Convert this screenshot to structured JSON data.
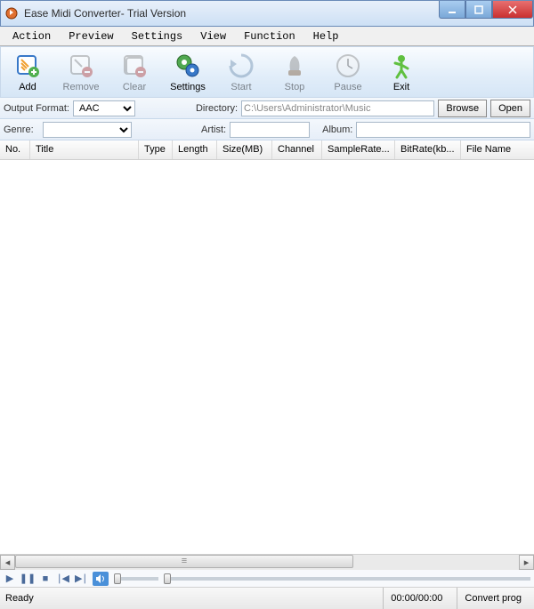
{
  "window": {
    "title": "Ease Midi Converter- Trial Version"
  },
  "menu": [
    "Action",
    "Preview",
    "Settings",
    "View",
    "Function",
    "Help"
  ],
  "toolbar": {
    "add": "Add",
    "remove": "Remove",
    "clear": "Clear",
    "settings": "Settings",
    "start": "Start",
    "stop": "Stop",
    "pause": "Pause",
    "exit": "Exit"
  },
  "form": {
    "output_format_label": "Output Format:",
    "output_format_value": "AAC",
    "directory_label": "Directory:",
    "directory_value": "C:\\Users\\Administrator\\Music",
    "browse": "Browse",
    "open": "Open",
    "genre_label": "Genre:",
    "genre_value": "",
    "artist_label": "Artist:",
    "artist_value": "",
    "album_label": "Album:",
    "album_value": ""
  },
  "columns": {
    "no": "No.",
    "title": "Title",
    "type": "Type",
    "length": "Length",
    "size": "Size(MB)",
    "channel": "Channel",
    "samplerate": "SampleRate...",
    "bitrate": "BitRate(kb...",
    "filename": "File Name"
  },
  "status": {
    "ready": "Ready",
    "time": "00:00/00:00",
    "progress": "Convert prog"
  }
}
